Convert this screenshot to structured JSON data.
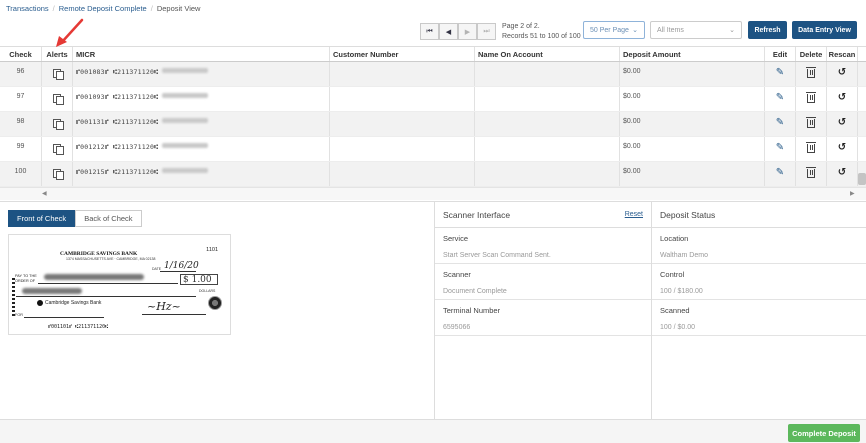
{
  "breadcrumb": [
    "Transactions",
    "Remote Deposit Complete",
    "Deposit View"
  ],
  "pager": {
    "first": "⏮",
    "prev": "◀",
    "next": "▶",
    "last": "⏭",
    "page_text": "Page 2 of 2.",
    "records_text": "Records 51 to 100 of 100"
  },
  "per_page": {
    "value": "50 Per Page"
  },
  "items_filter": {
    "value": "All Items"
  },
  "buttons": {
    "refresh": "Refresh",
    "data_entry": "Data Entry View",
    "complete": "Complete Deposit"
  },
  "grid": {
    "columns": [
      "Check",
      "Alerts",
      "MICR",
      "Customer Number",
      "Name On Account",
      "Deposit Amount",
      "Edit",
      "Delete",
      "Rescan"
    ],
    "rows": [
      {
        "check": "96",
        "micr": "⑈001083⑈ ⑆211371120⑆",
        "amount": "$0.00"
      },
      {
        "check": "97",
        "micr": "⑈001093⑈ ⑆211371120⑆",
        "amount": "$0.00"
      },
      {
        "check": "98",
        "micr": "⑈001131⑈ ⑆211371120⑆",
        "amount": "$0.00"
      },
      {
        "check": "99",
        "micr": "⑈001212⑈ ⑆211371120⑆",
        "amount": "$0.00"
      },
      {
        "check": "100",
        "micr": "⑈001215⑈ ⑆211371120⑆",
        "amount": "$0.00"
      }
    ]
  },
  "tabs": {
    "front": "Front of Check",
    "back": "Back of Check"
  },
  "check_image": {
    "number": "1101",
    "bank": "CAMBRIDGE SAVINGS BANK",
    "bank_addr": "1374 MASSACHUSETTS AVE · CAMBRIDGE, MA 02138",
    "date_label": "DATE",
    "date": "1/16/20",
    "pay_label": "PAY TO THE ORDER OF",
    "amount": "$ 1.00",
    "dollars": "DOLLARS",
    "logo_text": "Cambridge Savings Bank",
    "for_label": "FOR",
    "micr": "⑈001101⑈ ⑆211371120⑆"
  },
  "scanner": {
    "title": "Scanner Interface",
    "reset": "Reset",
    "fields": [
      {
        "label": "Service",
        "value": "Start Server Scan Command Sent."
      },
      {
        "label": "Scanner",
        "value": "Document Complete"
      },
      {
        "label": "Terminal Number",
        "value": "6595066"
      }
    ]
  },
  "deposit": {
    "title": "Deposit Status",
    "fields": [
      {
        "label": "Location",
        "value": "Waltham Demo"
      },
      {
        "label": "Control",
        "value": "100 / $180.00"
      },
      {
        "label": "Scanned",
        "value": "100 / $0.00"
      }
    ]
  },
  "colors": {
    "primary": "#1d5383",
    "success": "#5cb85c",
    "annotation": "#e53935"
  }
}
